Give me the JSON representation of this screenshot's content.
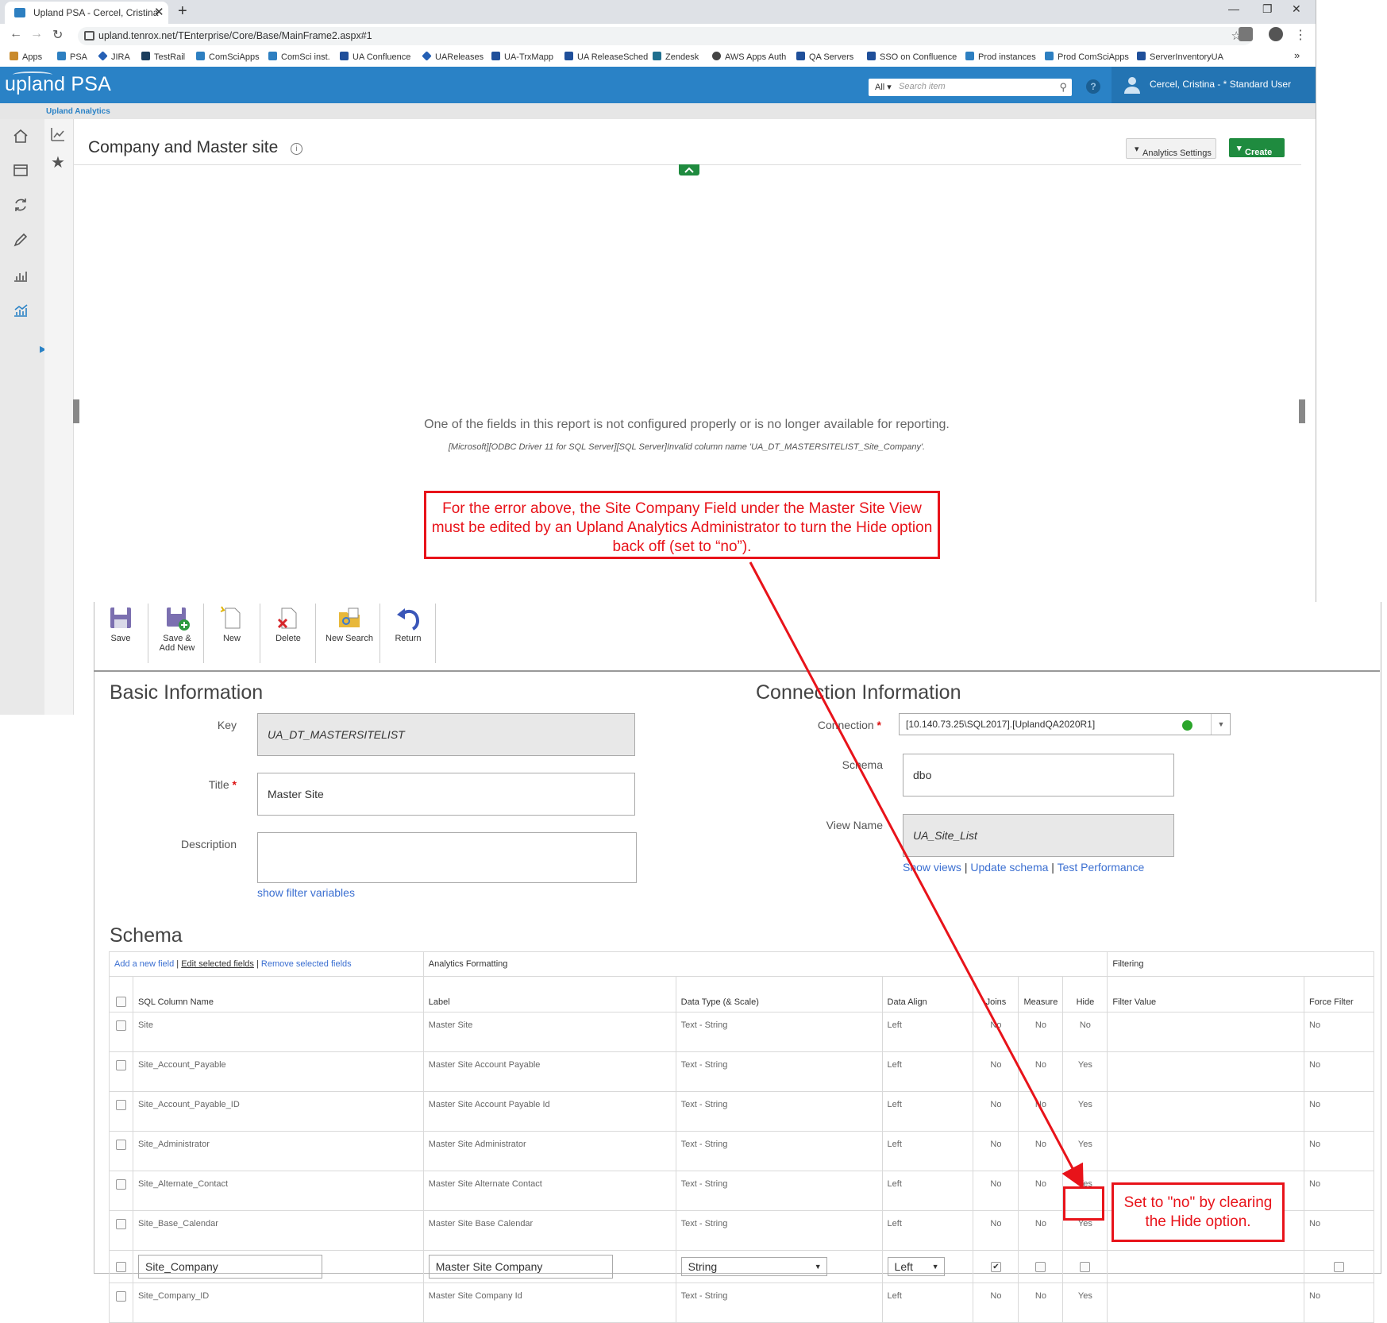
{
  "browser": {
    "tab_title": "Upland PSA - Cercel, Cristina",
    "url": "upland.tenrox.net/TEnterprise/Core/Base/MainFrame2.aspx#1",
    "bookmarks": [
      "Apps",
      "PSA",
      "JIRA",
      "TestRail",
      "ComSciApps",
      "ComSci inst.",
      "UA Confluence",
      "UAReleases",
      "UA-TrxMapp",
      "UA ReleaseSched",
      "Zendesk",
      "AWS Apps Auth",
      "QA Servers",
      "SSO on Confluence",
      "Prod instances",
      "Prod ComSciApps",
      "ServerInventoryUA"
    ],
    "overflow": "»"
  },
  "app": {
    "logo": "upland PSA",
    "search_scope": "All",
    "search_placeholder": "Search item",
    "help": "?",
    "user": "Cercel, Cristina - * Standard User",
    "breadcrumb": "Upland Analytics",
    "accent": "#2a82c6"
  },
  "report": {
    "title": "Company and Master site",
    "info": "i",
    "analytics_settings": "Analytics Settings",
    "create": "Create",
    "error": "One of the fields in this report is not configured properly or is no longer available for reporting.",
    "error_detail": "[Microsoft][ODBC Driver 11 for SQL Server][SQL Server]Invalid column name 'UA_DT_MASTERSITELIST_Site_Company'."
  },
  "callouts": {
    "top": "For the error above, the Site Company Field under the Master Site View must be edited by an Upland Analytics Administrator to turn the Hide option back off (set to “no”).",
    "bottom": "Set to \"no\" by clearing the Hide option.",
    "color": "#e8131a"
  },
  "toolbar": {
    "save": "Save",
    "save_new_1": "Save &",
    "save_new_2": "Add New",
    "new": "New",
    "delete": "Delete",
    "new_search": "New Search",
    "return": "Return"
  },
  "basic": {
    "heading": "Basic Information",
    "key_label": "Key",
    "key_value": "UA_DT_MASTERSITELIST",
    "title_label": "Title",
    "title_value": "Master Site",
    "desc_label": "Description",
    "desc_value": "",
    "filter_link": "show filter variables",
    "required": "*"
  },
  "connection": {
    "heading": "Connection Information",
    "conn_label": "Connection",
    "conn_value": "[10.140.73.25\\SQL2017].[UplandQA2020R1]",
    "schema_label": "Schema",
    "schema_value": "dbo",
    "view_label": "View Name",
    "view_value": "UA_Site_List",
    "link_show_views": "Show views",
    "link_update_schema": "Update schema",
    "link_test": "Test Performance",
    "sep": "|",
    "status_color": "#2aa52a"
  },
  "schema": {
    "heading": "Schema",
    "add": "Add a new field",
    "edit": "Edit selected fields",
    "remove": "Remove selected fields",
    "sep": "|",
    "group_formatting": "Analytics Formatting",
    "group_filtering": "Filtering",
    "columns": [
      "SQL Column Name",
      "Label",
      "Data Type (& Scale)",
      "Data Align",
      "Joins",
      "Measure",
      "Hide",
      "Filter Value",
      "Force Filter"
    ],
    "rows": [
      [
        "Site",
        "Master Site",
        "Text - String",
        "Left",
        "No",
        "No",
        "No",
        "",
        "No"
      ],
      [
        "Site_Account_Payable",
        "Master Site Account Payable",
        "Text - String",
        "Left",
        "No",
        "No",
        "Yes",
        "",
        "No"
      ],
      [
        "Site_Account_Payable_ID",
        "Master Site Account Payable Id",
        "Text - String",
        "Left",
        "No",
        "No",
        "Yes",
        "",
        "No"
      ],
      [
        "Site_Administrator",
        "Master Site Administrator",
        "Text - String",
        "Left",
        "No",
        "No",
        "Yes",
        "",
        "No"
      ],
      [
        "Site_Alternate_Contact",
        "Master Site Alternate Contact",
        "Text - String",
        "Left",
        "No",
        "No",
        "Yes",
        "",
        "No"
      ],
      [
        "Site_Base_Calendar",
        "Master Site Base Calendar",
        "Text - String",
        "Left",
        "No",
        "No",
        "Yes",
        "",
        "No"
      ]
    ],
    "edit_row": {
      "column": "Site_Company",
      "label": "Master Site Company",
      "type": "String",
      "align": "Left"
    },
    "last_row": [
      "Site_Company_ID",
      "Master Site Company Id",
      "Text - String",
      "Left",
      "No",
      "No",
      "Yes",
      "",
      "No"
    ]
  }
}
